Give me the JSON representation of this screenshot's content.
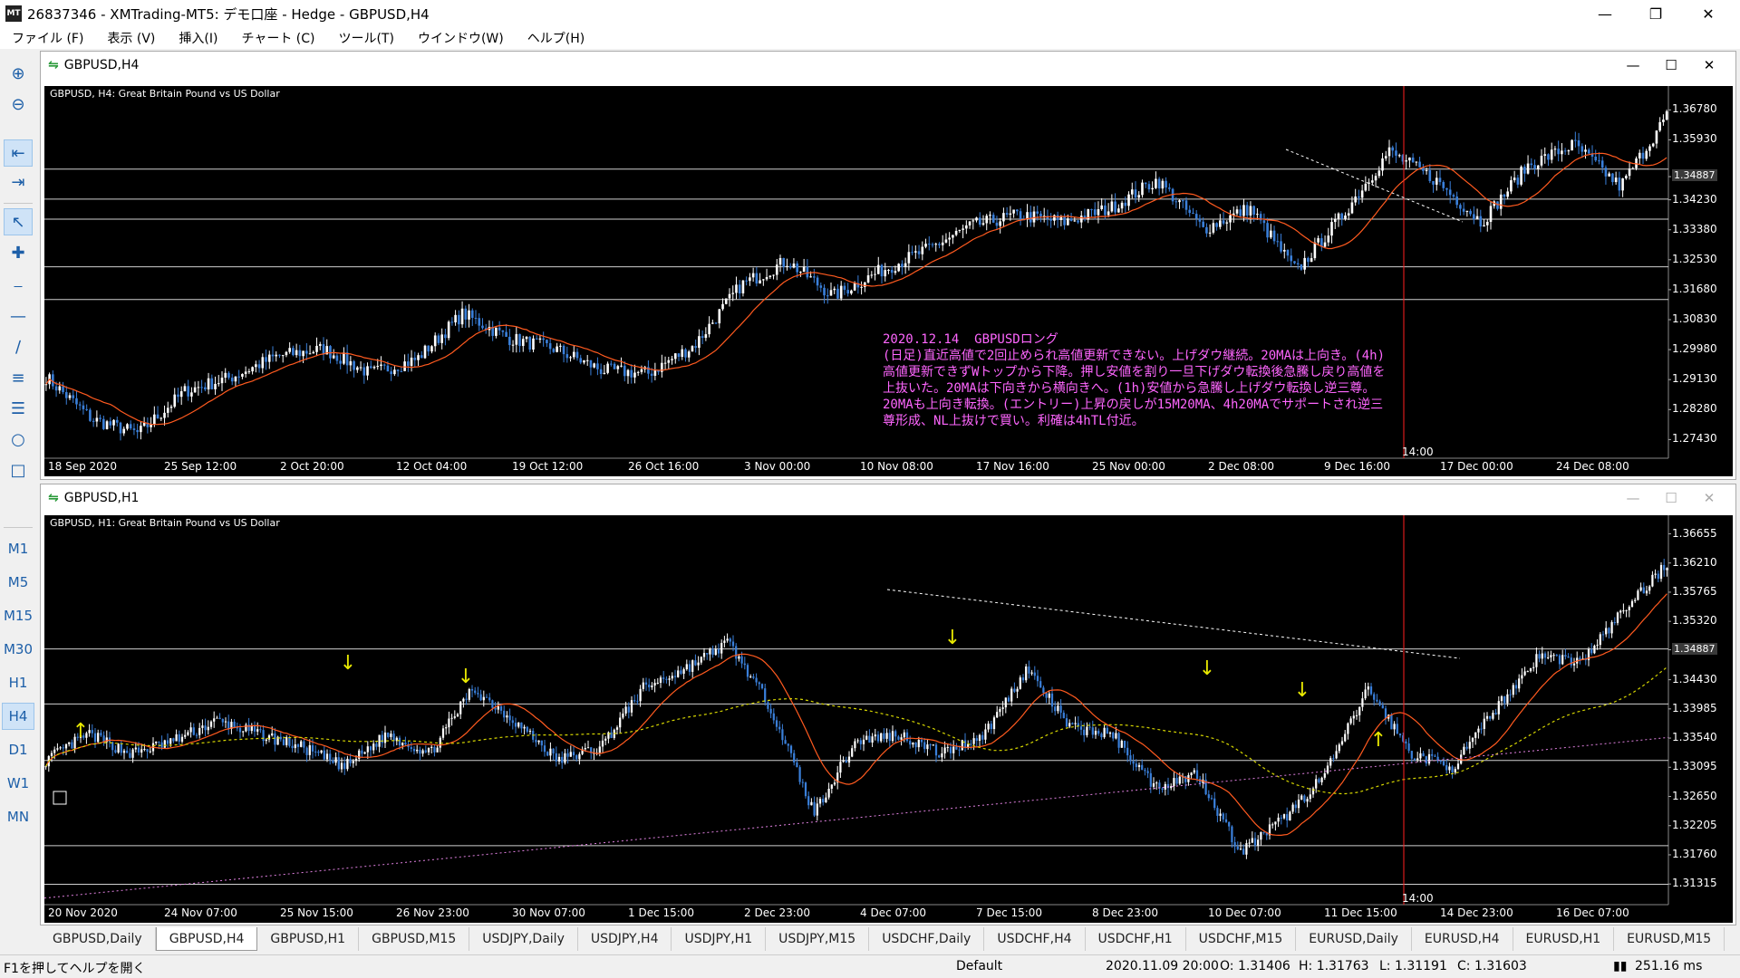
{
  "window": {
    "title": "26837346 - XMTrading-MT5: デモ口座 - Hedge - GBPUSD,H4",
    "app_icon": "MT"
  },
  "menu": [
    "ファイル (F)",
    "表示 (V)",
    "挿入(I)",
    "チャート (C)",
    "ツール(T)",
    "ウインドウ(W)",
    "ヘルプ(H)"
  ],
  "timeframes": [
    "M1",
    "M5",
    "M15",
    "M30",
    "H1",
    "H4",
    "D1",
    "W1",
    "MN"
  ],
  "active_timeframe": "H4",
  "chart_top": {
    "window_title": "GBPUSD,H4",
    "symbol_label": "GBPUSD, H4:  Great Britain Pound vs US Dollar",
    "price_ticks": [
      "1.36780",
      "1.35930",
      "1.34887",
      "1.34230",
      "1.33380",
      "1.32530",
      "1.31680",
      "1.30830",
      "1.29980",
      "1.29130",
      "1.28280",
      "1.27430"
    ],
    "current_price": "1.34887",
    "time_ticks": [
      "18 Sep 2020",
      "25 Sep 12:00",
      "2 Oct 20:00",
      "12 Oct 04:00",
      "19 Oct 12:00",
      "26 Oct 16:00",
      "3 Nov 00:00",
      "10 Nov 08:00",
      "17 Nov 16:00",
      "25 Nov 00:00",
      "2 Dec 08:00",
      "9 Dec 16:00",
      "17 Dec 00:00",
      "24 Dec 08:00"
    ],
    "vline_label": "14:00",
    "annotation": [
      "2020.12.14  GBPUSDロング",
      "(日足)直近高値で2回止められ高値更新できない。上げダウ継続。20MAは上向き。(4h)",
      "高値更新できずWトップから下降。押し安値を割り一旦下げダウ転換後急騰し戻り高値を",
      "上抜いた。20MAは下向きから横向きへ。(1h)安値から急騰し上げダウ転換し逆三尊。",
      "20MAも上向き転換。(エントリー)上昇の戻しが15M20MA、4h20MAでサポートされ逆三",
      "尊形成、NL上抜けで買い。利確は4hTL付近。"
    ],
    "chart_data": {
      "type": "candlestick",
      "series": [
        {
          "name": "MA",
          "values": []
        }
      ],
      "ylim": [
        1.269,
        1.372
      ]
    }
  },
  "chart_bottom": {
    "window_title": "GBPUSD,H1",
    "symbol_label": "GBPUSD, H1:  Great Britain Pound vs US Dollar",
    "price_ticks": [
      "1.36655",
      "1.36210",
      "1.35765",
      "1.35320",
      "1.34887",
      "1.34430",
      "1.33985",
      "1.33540",
      "1.33095",
      "1.32650",
      "1.32205",
      "1.31760",
      "1.31315"
    ],
    "current_price": "1.34887",
    "time_ticks": [
      "20 Nov 2020",
      "24 Nov 07:00",
      "25 Nov 15:00",
      "26 Nov 23:00",
      "30 Nov 07:00",
      "1 Dec 15:00",
      "2 Dec 23:00",
      "4 Dec 07:00",
      "7 Dec 15:00",
      "8 Dec 23:00",
      "10 Dec 07:00",
      "11 Dec 15:00",
      "14 Dec 23:00",
      "16 Dec 07:00"
    ],
    "vline_label": "14:00",
    "chart_data": {
      "type": "candlestick",
      "ylim": [
        1.31,
        1.368
      ]
    }
  },
  "tabs": [
    "GBPUSD,Daily",
    "GBPUSD,H4",
    "GBPUSD,H1",
    "GBPUSD,M15",
    "USDJPY,Daily",
    "USDJPY,H4",
    "USDJPY,H1",
    "USDJPY,M15",
    "USDCHF,Daily",
    "USDCHF,H4",
    "USDCHF,H1",
    "USDCHF,M15",
    "EURUSD,Daily",
    "EURUSD,H4",
    "EURUSD,H1",
    "EURUSD,M15"
  ],
  "active_tab": "GBPUSD,H4",
  "status": {
    "help": "F1を押してヘルプを開く",
    "profile": "Default",
    "time": "2020.11.09 20:00",
    "open": "O: 1.31406",
    "high": "H: 1.31763",
    "low": "L: 1.31191",
    "close": "C: 1.31603",
    "ping": "251.16 ms"
  },
  "colors": {
    "bull": "#ffffff",
    "bear": "#3a7fd9",
    "ma": "#ff5a1f",
    "ma_slow": "#d6d600",
    "ma_200": "#e080e0",
    "annotation": "#ff66ff",
    "vline": "#ff2020"
  }
}
